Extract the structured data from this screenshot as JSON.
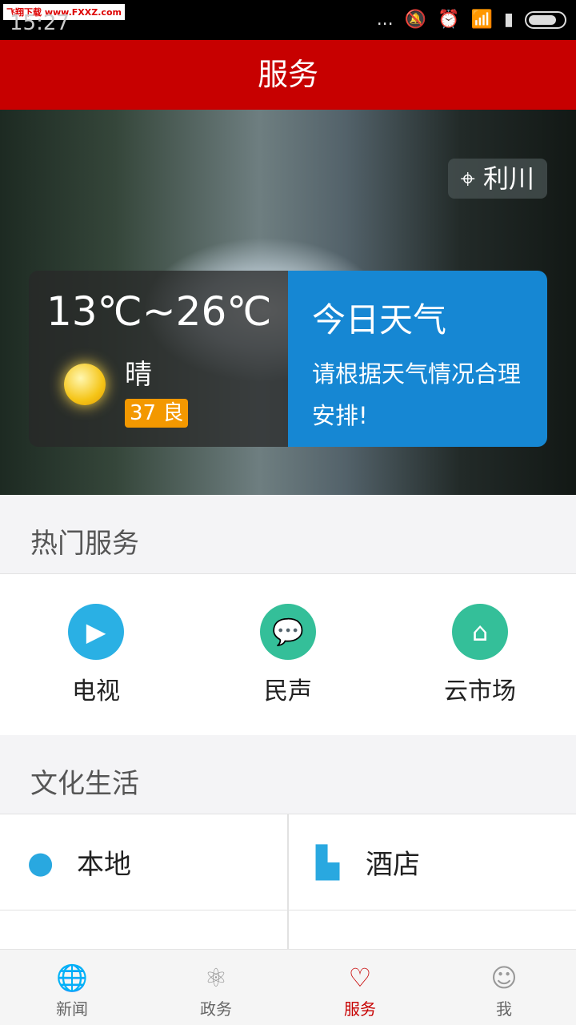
{
  "status_bar": {
    "watermark": "飞翔下载 www.FXXZ.com",
    "time": "15:27",
    "dots": "..."
  },
  "header": {
    "title": "服务"
  },
  "weather": {
    "location": "利川",
    "temperature": "13℃~26℃",
    "condition": "晴",
    "aqi": "37 良",
    "title": "今日天气",
    "message": "请根据天气情况合理安排!",
    "colors": {
      "panel": "#1687d3",
      "aqi_badge": "#f39800"
    }
  },
  "hot_services": {
    "title": "热门服务",
    "items": [
      {
        "label": "电视",
        "icon": "tv-icon",
        "color": "#2ab0e4"
      },
      {
        "label": "民声",
        "icon": "chat-icon",
        "color": "#34bf99"
      },
      {
        "label": "云市场",
        "icon": "cloud-market-icon",
        "color": "#34bf99"
      }
    ]
  },
  "culture": {
    "title": "文化生活",
    "items": [
      {
        "label": "本地",
        "icon": "location-pin-icon"
      },
      {
        "label": "酒店",
        "icon": "building-icon"
      },
      {
        "label": "",
        "icon": "person-icon"
      },
      {
        "label": "",
        "icon": "book-icon"
      }
    ]
  },
  "bottom_nav": {
    "items": [
      {
        "label": "新闻",
        "icon": "globe-icon"
      },
      {
        "label": "政务",
        "icon": "atom-icon"
      },
      {
        "label": "服务",
        "icon": "hearts-icon",
        "active": true
      },
      {
        "label": "我",
        "icon": "user-icon"
      }
    ]
  },
  "theme": {
    "header": "#c70000"
  }
}
